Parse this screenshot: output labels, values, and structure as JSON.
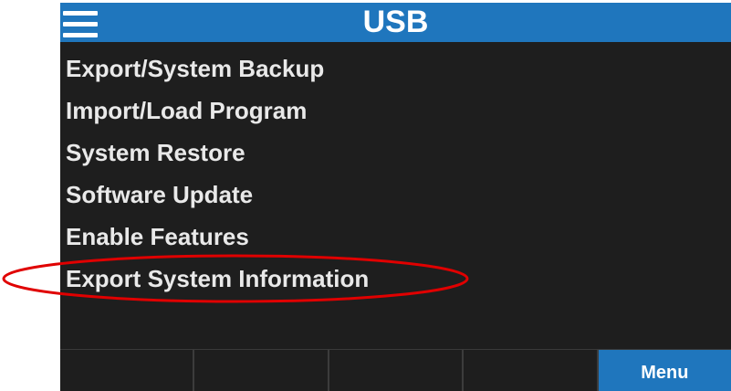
{
  "header": {
    "title": "USB",
    "menu_icon": "hamburger-menu-icon",
    "color": "#1f76bd"
  },
  "menu_items": [
    {
      "label": "Export/System Backup"
    },
    {
      "label": "Import/Load Program"
    },
    {
      "label": "System Restore"
    },
    {
      "label": "Software Update"
    },
    {
      "label": "Enable Features"
    },
    {
      "label": "Export System Information",
      "highlighted": true
    }
  ],
  "softkeys": [
    {
      "label": ""
    },
    {
      "label": ""
    },
    {
      "label": ""
    },
    {
      "label": ""
    },
    {
      "label": "Menu",
      "active": true
    }
  ],
  "annotation": {
    "shape": "ellipse",
    "color": "#e00000",
    "target": "Export System Information"
  }
}
